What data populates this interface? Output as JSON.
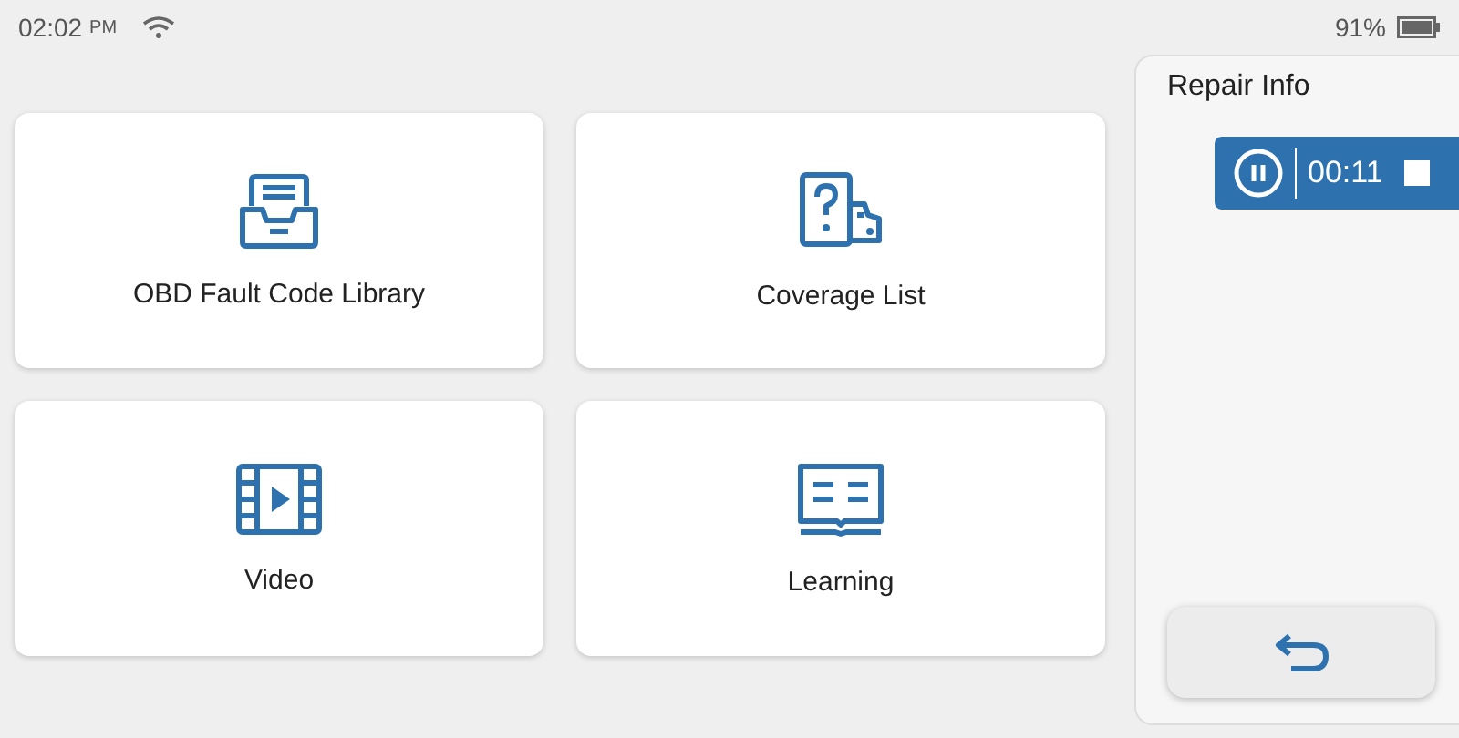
{
  "status_bar": {
    "time": "02:02",
    "meridiem": "PM",
    "battery": "91%"
  },
  "tiles": [
    {
      "kind": "library",
      "label": "OBD Fault Code Library"
    },
    {
      "kind": "coverage",
      "label": "Coverage List"
    },
    {
      "kind": "video",
      "label": "Video"
    },
    {
      "kind": "learning",
      "label": "Learning"
    }
  ],
  "repair_panel": {
    "title": "Repair Info",
    "recorder": {
      "elapsed": "00:11"
    }
  }
}
